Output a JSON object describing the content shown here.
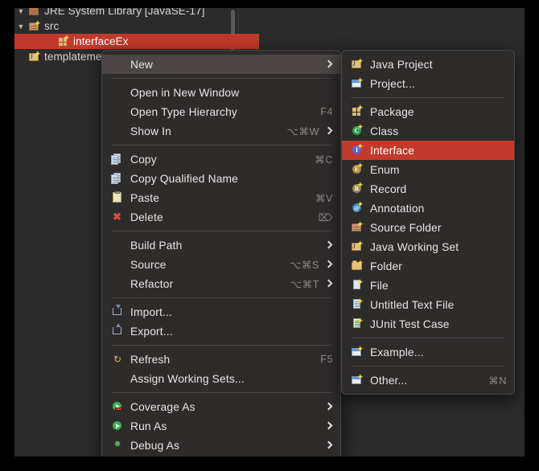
{
  "app": {
    "theme_bg": "#2b2b2b",
    "menu_bg": "#2e2b2b",
    "accent_red": "#c3392c",
    "hover_grey": "#4b4545"
  },
  "package_explorer": {
    "rows": [
      {
        "label": "JRE System Library  [JavaSE-17]",
        "icon": "library-icon",
        "arrow": "chevron-down-icon",
        "indent": 0,
        "selected": false,
        "clipped": true
      },
      {
        "label": "src",
        "icon": "source-folder-icon",
        "arrow": "chevron-down-icon",
        "indent": 0,
        "selected": false,
        "clipped": false
      },
      {
        "label": "interfaceEx",
        "icon": "package-icon",
        "arrow": "",
        "indent": 2,
        "selected": true,
        "clipped": false
      },
      {
        "label": "templatemet",
        "icon": "java-project-icon",
        "arrow": "",
        "indent": 0,
        "selected": false,
        "clipped": true
      }
    ]
  },
  "context_menu": {
    "items": [
      {
        "label": "New",
        "icon": "",
        "shortcut": "",
        "submenu": true,
        "highlight": "grey"
      },
      {
        "separator": true
      },
      {
        "label": "Open in New Window",
        "icon": "",
        "shortcut": "",
        "submenu": false,
        "highlight": ""
      },
      {
        "label": "Open Type Hierarchy",
        "icon": "",
        "shortcut": "F4",
        "submenu": false,
        "highlight": ""
      },
      {
        "label": "Show In",
        "icon": "",
        "shortcut": "⌥⌘W",
        "submenu": true,
        "highlight": ""
      },
      {
        "separator": true
      },
      {
        "label": "Copy",
        "icon": "copy-icon",
        "shortcut": "⌘C",
        "submenu": false,
        "highlight": ""
      },
      {
        "label": "Copy Qualified Name",
        "icon": "copy-qualified-icon",
        "shortcut": "",
        "submenu": false,
        "highlight": ""
      },
      {
        "label": "Paste",
        "icon": "paste-icon",
        "shortcut": "⌘V",
        "submenu": false,
        "highlight": ""
      },
      {
        "label": "Delete",
        "icon": "delete-icon",
        "shortcut": "⌦",
        "submenu": false,
        "highlight": ""
      },
      {
        "separator": true
      },
      {
        "label": "Build Path",
        "icon": "",
        "shortcut": "",
        "submenu": true,
        "highlight": ""
      },
      {
        "label": "Source",
        "icon": "",
        "shortcut": "⌥⌘S",
        "submenu": true,
        "highlight": ""
      },
      {
        "label": "Refactor",
        "icon": "",
        "shortcut": "⌥⌘T",
        "submenu": true,
        "highlight": ""
      },
      {
        "separator": true
      },
      {
        "label": "Import...",
        "icon": "import-icon",
        "shortcut": "",
        "submenu": false,
        "highlight": ""
      },
      {
        "label": "Export...",
        "icon": "export-icon",
        "shortcut": "",
        "submenu": false,
        "highlight": ""
      },
      {
        "separator": true
      },
      {
        "label": "Refresh",
        "icon": "refresh-icon",
        "shortcut": "F5",
        "submenu": false,
        "highlight": ""
      },
      {
        "label": "Assign Working Sets...",
        "icon": "",
        "shortcut": "",
        "submenu": false,
        "highlight": ""
      },
      {
        "separator": true
      },
      {
        "label": "Coverage As",
        "icon": "coverage-icon",
        "shortcut": "",
        "submenu": true,
        "highlight": ""
      },
      {
        "label": "Run As",
        "icon": "run-icon",
        "shortcut": "",
        "submenu": true,
        "highlight": ""
      },
      {
        "label": "Debug As",
        "icon": "debug-icon",
        "shortcut": "",
        "submenu": true,
        "highlight": ""
      }
    ]
  },
  "new_submenu": {
    "items": [
      {
        "label": "Java Project",
        "icon": "java-project-icon",
        "shortcut": "",
        "highlight": ""
      },
      {
        "label": "Project...",
        "icon": "project-icon",
        "shortcut": "",
        "highlight": ""
      },
      {
        "separator": true
      },
      {
        "label": "Package",
        "icon": "package-icon",
        "shortcut": "",
        "highlight": ""
      },
      {
        "label": "Class",
        "icon": "class-icon",
        "shortcut": "",
        "highlight": ""
      },
      {
        "label": "Interface",
        "icon": "interface-icon",
        "shortcut": "",
        "highlight": "red"
      },
      {
        "label": "Enum",
        "icon": "enum-icon",
        "shortcut": "",
        "highlight": ""
      },
      {
        "label": "Record",
        "icon": "record-icon",
        "shortcut": "",
        "highlight": ""
      },
      {
        "label": "Annotation",
        "icon": "annotation-icon",
        "shortcut": "",
        "highlight": ""
      },
      {
        "label": "Source Folder",
        "icon": "source-folder-icon",
        "shortcut": "",
        "highlight": ""
      },
      {
        "label": "Java Working Set",
        "icon": "java-working-set-icon",
        "shortcut": "",
        "highlight": ""
      },
      {
        "label": "Folder",
        "icon": "folder-icon",
        "shortcut": "",
        "highlight": ""
      },
      {
        "label": "File",
        "icon": "file-icon",
        "shortcut": "",
        "highlight": ""
      },
      {
        "label": "Untitled Text File",
        "icon": "text-file-icon",
        "shortcut": "",
        "highlight": ""
      },
      {
        "label": "JUnit Test Case",
        "icon": "junit-icon",
        "shortcut": "",
        "highlight": ""
      },
      {
        "separator": true
      },
      {
        "label": "Example...",
        "icon": "example-icon",
        "shortcut": "",
        "highlight": ""
      },
      {
        "separator": true
      },
      {
        "label": "Other...",
        "icon": "other-icon",
        "shortcut": "⌘N",
        "highlight": ""
      }
    ]
  }
}
